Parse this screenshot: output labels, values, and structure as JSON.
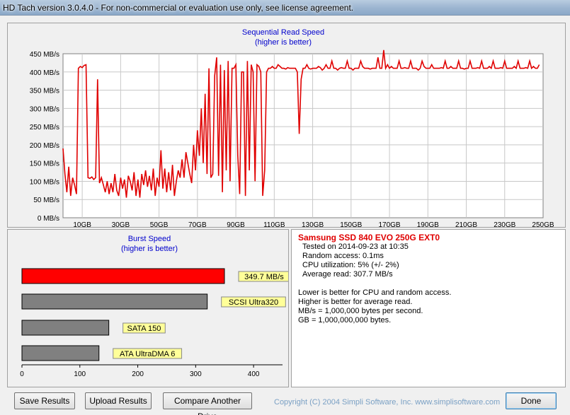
{
  "window": {
    "title": "HD Tach version 3.0.4.0  - For non-commercial or evaluation use only, see license agreement."
  },
  "colors": {
    "read_line": "#e00000",
    "title_blue": "#0000cc",
    "burst_highlight": "#ff0000",
    "burst_other": "#808080",
    "label_bg": "#ffff99"
  },
  "chart_data": [
    {
      "type": "line",
      "title": "Sequential Read Speed",
      "subtitle": "(higher is better)",
      "ylabel_unit": "MB/s",
      "ylim": [
        0,
        450
      ],
      "yticks": [
        "0 MB/s",
        "50 MB/s",
        "100 MB/s",
        "150 MB/s",
        "200 MB/s",
        "250 MB/s",
        "300 MB/s",
        "350 MB/s",
        "400 MB/s",
        "450 MB/s"
      ],
      "xlim": [
        0,
        250
      ],
      "xticks": [
        "10GB",
        "30GB",
        "50GB",
        "70GB",
        "90GB",
        "110GB",
        "130GB",
        "150GB",
        "170GB",
        "190GB",
        "210GB",
        "230GB",
        "250GB"
      ],
      "grid": true,
      "x": [
        0,
        1,
        2,
        3,
        4,
        5,
        6,
        7,
        8,
        9,
        10,
        11,
        12,
        13,
        14,
        15,
        16,
        17,
        18,
        19,
        20,
        21,
        22,
        23,
        24,
        25,
        26,
        27,
        28,
        29,
        30,
        31,
        32,
        33,
        34,
        35,
        36,
        37,
        38,
        39,
        40,
        41,
        42,
        43,
        44,
        45,
        46,
        47,
        48,
        49,
        50,
        51,
        52,
        53,
        54,
        55,
        56,
        57,
        58,
        59,
        60,
        61,
        62,
        63,
        64,
        65,
        66,
        67,
        68,
        69,
        70,
        71,
        72,
        73,
        74,
        75,
        76,
        77,
        78,
        79,
        80,
        81,
        82,
        83,
        84,
        85,
        86,
        87,
        88,
        89,
        90,
        91,
        92,
        93,
        94,
        95,
        96,
        97,
        98,
        99,
        100,
        101,
        102,
        103,
        104,
        105,
        106,
        107,
        108,
        109,
        110,
        111,
        112,
        113,
        114,
        115,
        116,
        117,
        118,
        119,
        120,
        121,
        122,
        123,
        124,
        125,
        126,
        127,
        128,
        129,
        130,
        131,
        132,
        133,
        134,
        135,
        136,
        137,
        138,
        139,
        140,
        141,
        142,
        143,
        144,
        145,
        146,
        147,
        148,
        149,
        150,
        151,
        152,
        153,
        154,
        155,
        156,
        157,
        158,
        159,
        160,
        161,
        162,
        163,
        164,
        165,
        166,
        167,
        168,
        169,
        170,
        171,
        172,
        173,
        174,
        175,
        176,
        177,
        178,
        179,
        180,
        181,
        182,
        183,
        184,
        185,
        186,
        187,
        188,
        189,
        190,
        191,
        192,
        193,
        194,
        195,
        196,
        197,
        198,
        199,
        200,
        201,
        202,
        203,
        204,
        205,
        206,
        207,
        208,
        209,
        210,
        211,
        212,
        213,
        214,
        215,
        216,
        217,
        218,
        219,
        220,
        221,
        222,
        223,
        224,
        225,
        226,
        227,
        228,
        229,
        230,
        231,
        232,
        233,
        234,
        235,
        236,
        237,
        238,
        239,
        240,
        241,
        242,
        243,
        244,
        245,
        246,
        247,
        248,
        249,
        250
      ],
      "series": [
        {
          "values": [
            190,
            120,
            70,
            140,
            60,
            110,
            90,
            65,
            410,
            415,
            412,
            418,
            420,
            110,
            108,
            112,
            105,
            110,
            380,
            95,
            110,
            90,
            70,
            100,
            65,
            95,
            70,
            120,
            75,
            60,
            110,
            80,
            105,
            55,
            115,
            100,
            75,
            125,
            60,
            105,
            55,
            120,
            90,
            130,
            85,
            115,
            75,
            135,
            60,
            110,
            85,
            185,
            80,
            135,
            70,
            125,
            75,
            145,
            60,
            100,
            130,
            110,
            160,
            110,
            180,
            150,
            120,
            95,
            200,
            130,
            240,
            170,
            300,
            150,
            340,
            120,
            410,
            110,
            120,
            390,
            440,
            115,
            420,
            70,
            405,
            130,
            430,
            100,
            410,
            410,
            420,
            170,
            65,
            400,
            400,
            60,
            430,
            130,
            420,
            400,
            100,
            420,
            415,
            400,
            60,
            130,
            400,
            410,
            410,
            415,
            410,
            410,
            420,
            415,
            410,
            410,
            408,
            412,
            410,
            410,
            410,
            410,
            400,
            230,
            380,
            410,
            410,
            420,
            410,
            408,
            410,
            410,
            410,
            415,
            412,
            405,
            410,
            420,
            410,
            410,
            430,
            410,
            410,
            405,
            410,
            412,
            410,
            410,
            430,
            410,
            410,
            405,
            410,
            410,
            410,
            430,
            415,
            410,
            410,
            410,
            408,
            410,
            410,
            410,
            440,
            410,
            410,
            460,
            410,
            420,
            410,
            415,
            410,
            410,
            410,
            430,
            410,
            410,
            412,
            410,
            410,
            430,
            410,
            410,
            410,
            405,
            410,
            430,
            415,
            410,
            410,
            410,
            420,
            410,
            410,
            410,
            410,
            412,
            410,
            430,
            410,
            410,
            415,
            410,
            410,
            410,
            430,
            410,
            410,
            408,
            410,
            410,
            430,
            410,
            410,
            410,
            412,
            410,
            430,
            410,
            410,
            410,
            415,
            410,
            430,
            410,
            410,
            410,
            412,
            410,
            430,
            410,
            410,
            410,
            410,
            415,
            410,
            430,
            410,
            410,
            410,
            412,
            410,
            430,
            410,
            415,
            410,
            410,
            420
          ]
        }
      ]
    },
    {
      "type": "bar",
      "orientation": "horizontal",
      "title": "Burst Speed",
      "subtitle": "(higher is better)",
      "xlim": [
        0,
        450
      ],
      "xticks": [
        "0",
        "100",
        "200",
        "300",
        "400"
      ],
      "grid": false,
      "categories": [
        "349.7 MB/s",
        "SCSI Ultra320",
        "SATA 150",
        "ATA UltraDMA 6"
      ],
      "values": [
        349.7,
        320,
        150,
        133
      ],
      "highlight": [
        true,
        false,
        false,
        false
      ]
    }
  ],
  "info": {
    "title": "Samsung SSD 840 EVO 250G EXT0",
    "lines": [
      "Tested on 2014-09-23 at 10:35",
      "Random access: 0.1ms",
      "CPU utilization: 5% (+/- 2%)",
      "Average read: 307.7 MB/s"
    ],
    "notes": [
      "Lower is better for CPU and random access.",
      "Higher is better for average read.",
      "MB/s = 1,000,000 bytes per second.",
      "GB = 1,000,000,000 bytes."
    ]
  },
  "buttons": {
    "save": "Save Results",
    "upload": "Upload Results",
    "compare": "Compare Another Drive",
    "done": "Done"
  },
  "copyright": "Copyright (C) 2004 Simpli Software, Inc. www.simplisoftware.com"
}
